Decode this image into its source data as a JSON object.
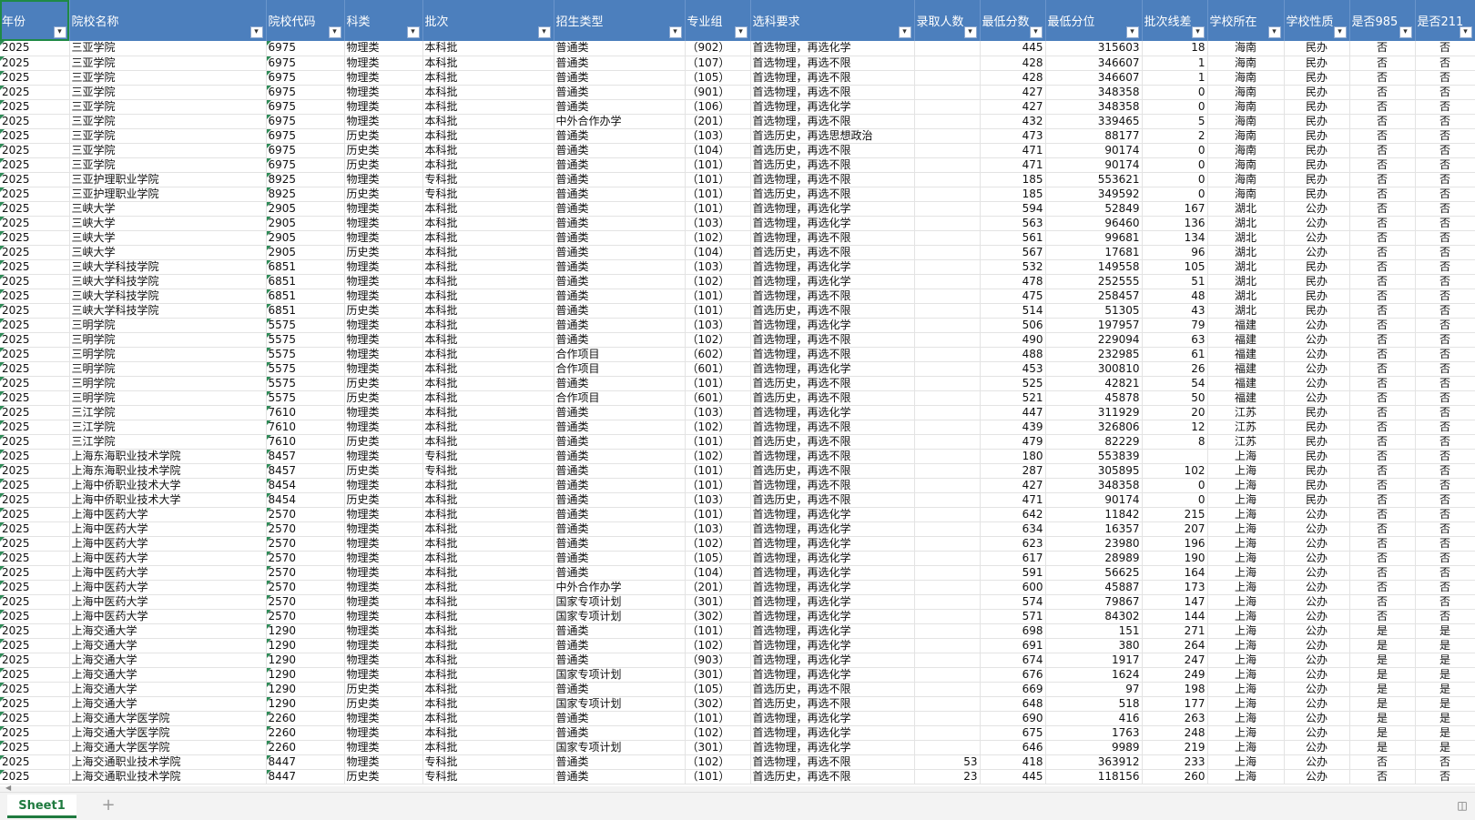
{
  "sheet": {
    "columns": [
      "年份",
      "院校名称",
      "院校代码",
      "科类",
      "批次",
      "招生类型",
      "专业组",
      "选科要求",
      "录取人数",
      "最低分数",
      "最低分位",
      "批次线差",
      "学校所在",
      "学校性质",
      "是否985",
      "是否211"
    ],
    "rows": [
      [
        "2025",
        "三亚学院",
        "6975",
        "物理类",
        "本科批",
        "普通类",
        "（902）",
        "首选物理，再选化学",
        "",
        "445",
        "315603",
        "18",
        "海南",
        "民办",
        "否",
        "否"
      ],
      [
        "2025",
        "三亚学院",
        "6975",
        "物理类",
        "本科批",
        "普通类",
        "（107）",
        "首选物理，再选不限",
        "",
        "428",
        "346607",
        "1",
        "海南",
        "民办",
        "否",
        "否"
      ],
      [
        "2025",
        "三亚学院",
        "6975",
        "物理类",
        "本科批",
        "普通类",
        "（105）",
        "首选物理，再选不限",
        "",
        "428",
        "346607",
        "1",
        "海南",
        "民办",
        "否",
        "否"
      ],
      [
        "2025",
        "三亚学院",
        "6975",
        "物理类",
        "本科批",
        "普通类",
        "（901）",
        "首选物理，再选不限",
        "",
        "427",
        "348358",
        "0",
        "海南",
        "民办",
        "否",
        "否"
      ],
      [
        "2025",
        "三亚学院",
        "6975",
        "物理类",
        "本科批",
        "普通类",
        "（106）",
        "首选物理，再选化学",
        "",
        "427",
        "348358",
        "0",
        "海南",
        "民办",
        "否",
        "否"
      ],
      [
        "2025",
        "三亚学院",
        "6975",
        "物理类",
        "本科批",
        "中外合作办学",
        "（201）",
        "首选物理，再选不限",
        "",
        "432",
        "339465",
        "5",
        "海南",
        "民办",
        "否",
        "否"
      ],
      [
        "2025",
        "三亚学院",
        "6975",
        "历史类",
        "本科批",
        "普通类",
        "（103）",
        "首选历史，再选思想政治",
        "",
        "473",
        "88177",
        "2",
        "海南",
        "民办",
        "否",
        "否"
      ],
      [
        "2025",
        "三亚学院",
        "6975",
        "历史类",
        "本科批",
        "普通类",
        "（104）",
        "首选历史，再选不限",
        "",
        "471",
        "90174",
        "0",
        "海南",
        "民办",
        "否",
        "否"
      ],
      [
        "2025",
        "三亚学院",
        "6975",
        "历史类",
        "本科批",
        "普通类",
        "（101）",
        "首选历史，再选不限",
        "",
        "471",
        "90174",
        "0",
        "海南",
        "民办",
        "否",
        "否"
      ],
      [
        "2025",
        "三亚护理职业学院",
        "8925",
        "物理类",
        "专科批",
        "普通类",
        "（101）",
        "首选物理，再选不限",
        "",
        "185",
        "553621",
        "0",
        "海南",
        "民办",
        "否",
        "否"
      ],
      [
        "2025",
        "三亚护理职业学院",
        "8925",
        "历史类",
        "专科批",
        "普通类",
        "（101）",
        "首选历史，再选不限",
        "",
        "185",
        "349592",
        "0",
        "海南",
        "民办",
        "否",
        "否"
      ],
      [
        "2025",
        "三峡大学",
        "2905",
        "物理类",
        "本科批",
        "普通类",
        "（101）",
        "首选物理，再选化学",
        "",
        "594",
        "52849",
        "167",
        "湖北",
        "公办",
        "否",
        "否"
      ],
      [
        "2025",
        "三峡大学",
        "2905",
        "物理类",
        "本科批",
        "普通类",
        "（103）",
        "首选物理，再选化学",
        "",
        "563",
        "96460",
        "136",
        "湖北",
        "公办",
        "否",
        "否"
      ],
      [
        "2025",
        "三峡大学",
        "2905",
        "物理类",
        "本科批",
        "普通类",
        "（102）",
        "首选物理，再选不限",
        "",
        "561",
        "99681",
        "134",
        "湖北",
        "公办",
        "否",
        "否"
      ],
      [
        "2025",
        "三峡大学",
        "2905",
        "历史类",
        "本科批",
        "普通类",
        "（104）",
        "首选历史，再选不限",
        "",
        "567",
        "17681",
        "96",
        "湖北",
        "公办",
        "否",
        "否"
      ],
      [
        "2025",
        "三峡大学科技学院",
        "6851",
        "物理类",
        "本科批",
        "普通类",
        "（103）",
        "首选物理，再选化学",
        "",
        "532",
        "149558",
        "105",
        "湖北",
        "民办",
        "否",
        "否"
      ],
      [
        "2025",
        "三峡大学科技学院",
        "6851",
        "物理类",
        "本科批",
        "普通类",
        "（102）",
        "首选物理，再选化学",
        "",
        "478",
        "252555",
        "51",
        "湖北",
        "民办",
        "否",
        "否"
      ],
      [
        "2025",
        "三峡大学科技学院",
        "6851",
        "物理类",
        "本科批",
        "普通类",
        "（101）",
        "首选物理，再选不限",
        "",
        "475",
        "258457",
        "48",
        "湖北",
        "民办",
        "否",
        "否"
      ],
      [
        "2025",
        "三峡大学科技学院",
        "6851",
        "历史类",
        "本科批",
        "普通类",
        "（101）",
        "首选历史，再选不限",
        "",
        "514",
        "51305",
        "43",
        "湖北",
        "民办",
        "否",
        "否"
      ],
      [
        "2025",
        "三明学院",
        "5575",
        "物理类",
        "本科批",
        "普通类",
        "（103）",
        "首选物理，再选化学",
        "",
        "506",
        "197957",
        "79",
        "福建",
        "公办",
        "否",
        "否"
      ],
      [
        "2025",
        "三明学院",
        "5575",
        "物理类",
        "本科批",
        "普通类",
        "（102）",
        "首选物理，再选不限",
        "",
        "490",
        "229094",
        "63",
        "福建",
        "公办",
        "否",
        "否"
      ],
      [
        "2025",
        "三明学院",
        "5575",
        "物理类",
        "本科批",
        "合作项目",
        "（602）",
        "首选物理，再选不限",
        "",
        "488",
        "232985",
        "61",
        "福建",
        "公办",
        "否",
        "否"
      ],
      [
        "2025",
        "三明学院",
        "5575",
        "物理类",
        "本科批",
        "合作项目",
        "（601）",
        "首选物理，再选化学",
        "",
        "453",
        "300810",
        "26",
        "福建",
        "公办",
        "否",
        "否"
      ],
      [
        "2025",
        "三明学院",
        "5575",
        "历史类",
        "本科批",
        "普通类",
        "（101）",
        "首选历史，再选不限",
        "",
        "525",
        "42821",
        "54",
        "福建",
        "公办",
        "否",
        "否"
      ],
      [
        "2025",
        "三明学院",
        "5575",
        "历史类",
        "本科批",
        "合作项目",
        "（601）",
        "首选历史，再选不限",
        "",
        "521",
        "45878",
        "50",
        "福建",
        "公办",
        "否",
        "否"
      ],
      [
        "2025",
        "三江学院",
        "7610",
        "物理类",
        "本科批",
        "普通类",
        "（103）",
        "首选物理，再选化学",
        "",
        "447",
        "311929",
        "20",
        "江苏",
        "民办",
        "否",
        "否"
      ],
      [
        "2025",
        "三江学院",
        "7610",
        "物理类",
        "本科批",
        "普通类",
        "（102）",
        "首选物理，再选不限",
        "",
        "439",
        "326806",
        "12",
        "江苏",
        "民办",
        "否",
        "否"
      ],
      [
        "2025",
        "三江学院",
        "7610",
        "历史类",
        "本科批",
        "普通类",
        "（101）",
        "首选历史，再选不限",
        "",
        "479",
        "82229",
        "8",
        "江苏",
        "民办",
        "否",
        "否"
      ],
      [
        "2025",
        "上海东海职业技术学院",
        "8457",
        "物理类",
        "专科批",
        "普通类",
        "（102）",
        "首选物理，再选不限",
        "",
        "180",
        "553839",
        "",
        "上海",
        "民办",
        "否",
        "否"
      ],
      [
        "2025",
        "上海东海职业技术学院",
        "8457",
        "历史类",
        "专科批",
        "普通类",
        "（101）",
        "首选历史，再选不限",
        "",
        "287",
        "305895",
        "102",
        "上海",
        "民办",
        "否",
        "否"
      ],
      [
        "2025",
        "上海中侨职业技术大学",
        "8454",
        "物理类",
        "本科批",
        "普通类",
        "（101）",
        "首选物理，再选不限",
        "",
        "427",
        "348358",
        "0",
        "上海",
        "民办",
        "否",
        "否"
      ],
      [
        "2025",
        "上海中侨职业技术大学",
        "8454",
        "历史类",
        "本科批",
        "普通类",
        "（103）",
        "首选历史，再选不限",
        "",
        "471",
        "90174",
        "0",
        "上海",
        "民办",
        "否",
        "否"
      ],
      [
        "2025",
        "上海中医药大学",
        "2570",
        "物理类",
        "本科批",
        "普通类",
        "（101）",
        "首选物理，再选化学",
        "",
        "642",
        "11842",
        "215",
        "上海",
        "公办",
        "否",
        "否"
      ],
      [
        "2025",
        "上海中医药大学",
        "2570",
        "物理类",
        "本科批",
        "普通类",
        "（103）",
        "首选物理，再选化学",
        "",
        "634",
        "16357",
        "207",
        "上海",
        "公办",
        "否",
        "否"
      ],
      [
        "2025",
        "上海中医药大学",
        "2570",
        "物理类",
        "本科批",
        "普通类",
        "（102）",
        "首选物理，再选化学",
        "",
        "623",
        "23980",
        "196",
        "上海",
        "公办",
        "否",
        "否"
      ],
      [
        "2025",
        "上海中医药大学",
        "2570",
        "物理类",
        "本科批",
        "普通类",
        "（105）",
        "首选物理，再选化学",
        "",
        "617",
        "28989",
        "190",
        "上海",
        "公办",
        "否",
        "否"
      ],
      [
        "2025",
        "上海中医药大学",
        "2570",
        "物理类",
        "本科批",
        "普通类",
        "（104）",
        "首选物理，再选化学",
        "",
        "591",
        "56625",
        "164",
        "上海",
        "公办",
        "否",
        "否"
      ],
      [
        "2025",
        "上海中医药大学",
        "2570",
        "物理类",
        "本科批",
        "中外合作办学",
        "（201）",
        "首选物理，再选化学",
        "",
        "600",
        "45887",
        "173",
        "上海",
        "公办",
        "否",
        "否"
      ],
      [
        "2025",
        "上海中医药大学",
        "2570",
        "物理类",
        "本科批",
        "国家专项计划",
        "（301）",
        "首选物理，再选化学",
        "",
        "574",
        "79867",
        "147",
        "上海",
        "公办",
        "否",
        "否"
      ],
      [
        "2025",
        "上海中医药大学",
        "2570",
        "物理类",
        "本科批",
        "国家专项计划",
        "（302）",
        "首选物理，再选化学",
        "",
        "571",
        "84302",
        "144",
        "上海",
        "公办",
        "否",
        "否"
      ],
      [
        "2025",
        "上海交通大学",
        "1290",
        "物理类",
        "本科批",
        "普通类",
        "（101）",
        "首选物理，再选化学",
        "",
        "698",
        "151",
        "271",
        "上海",
        "公办",
        "是",
        "是"
      ],
      [
        "2025",
        "上海交通大学",
        "1290",
        "物理类",
        "本科批",
        "普通类",
        "（102）",
        "首选物理，再选化学",
        "",
        "691",
        "380",
        "264",
        "上海",
        "公办",
        "是",
        "是"
      ],
      [
        "2025",
        "上海交通大学",
        "1290",
        "物理类",
        "本科批",
        "普通类",
        "（903）",
        "首选物理，再选化学",
        "",
        "674",
        "1917",
        "247",
        "上海",
        "公办",
        "是",
        "是"
      ],
      [
        "2025",
        "上海交通大学",
        "1290",
        "物理类",
        "本科批",
        "国家专项计划",
        "（301）",
        "首选物理，再选化学",
        "",
        "676",
        "1624",
        "249",
        "上海",
        "公办",
        "是",
        "是"
      ],
      [
        "2025",
        "上海交通大学",
        "1290",
        "历史类",
        "本科批",
        "普通类",
        "（105）",
        "首选历史，再选不限",
        "",
        "669",
        "97",
        "198",
        "上海",
        "公办",
        "是",
        "是"
      ],
      [
        "2025",
        "上海交通大学",
        "1290",
        "历史类",
        "本科批",
        "国家专项计划",
        "（302）",
        "首选历史，再选不限",
        "",
        "648",
        "518",
        "177",
        "上海",
        "公办",
        "是",
        "是"
      ],
      [
        "2025",
        "上海交通大学医学院",
        "2260",
        "物理类",
        "本科批",
        "普通类",
        "（101）",
        "首选物理，再选化学",
        "",
        "690",
        "416",
        "263",
        "上海",
        "公办",
        "是",
        "是"
      ],
      [
        "2025",
        "上海交通大学医学院",
        "2260",
        "物理类",
        "本科批",
        "普通类",
        "（102）",
        "首选物理，再选化学",
        "",
        "675",
        "1763",
        "248",
        "上海",
        "公办",
        "是",
        "是"
      ],
      [
        "2025",
        "上海交通大学医学院",
        "2260",
        "物理类",
        "本科批",
        "国家专项计划",
        "（301）",
        "首选物理，再选化学",
        "",
        "646",
        "9989",
        "219",
        "上海",
        "公办",
        "是",
        "是"
      ],
      [
        "2025",
        "上海交通职业技术学院",
        "8447",
        "物理类",
        "专科批",
        "普通类",
        "（102）",
        "首选物理，再选不限",
        "53",
        "418",
        "363912",
        "233",
        "上海",
        "公办",
        "否",
        "否"
      ],
      [
        "2025",
        "上海交通职业技术学院",
        "8447",
        "历史类",
        "专科批",
        "普通类",
        "（101）",
        "首选历史，再选不限",
        "23",
        "445",
        "118156",
        "260",
        "上海",
        "公办",
        "否",
        "否"
      ]
    ]
  },
  "tabs": {
    "active": "Sheet1",
    "add_glyph": "+"
  },
  "icons": {
    "filter": "filter-dropdown-icon",
    "add": "plus-icon",
    "corner": "sheet-list-icon"
  }
}
